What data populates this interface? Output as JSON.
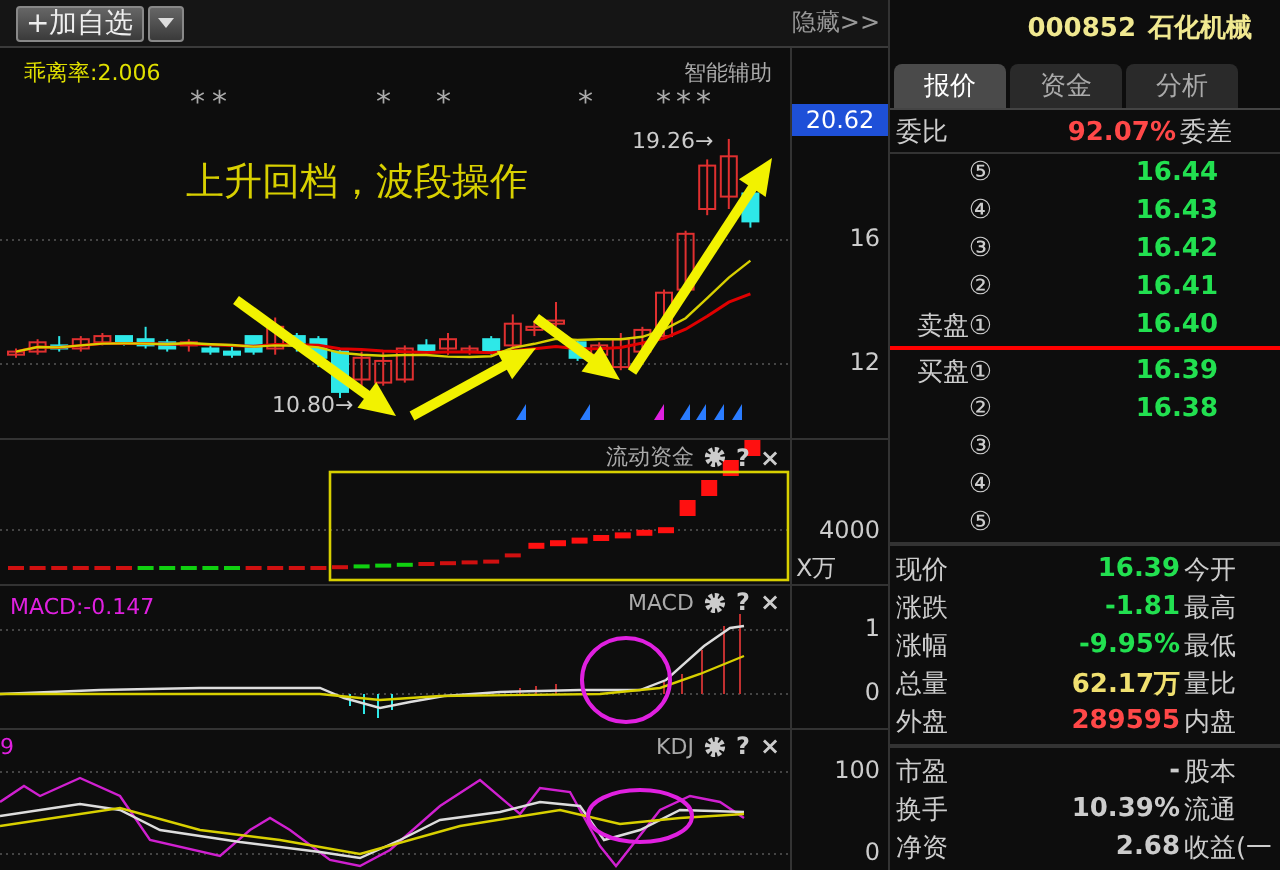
{
  "toolbar": {
    "add_button": "+加自选",
    "hide_link": "隐藏>>"
  },
  "main_chart": {
    "indicator": "乖离率:2.006",
    "assist_label": "智能辅助",
    "stars": [
      "*",
      "*",
      "*",
      "*",
      "*",
      "*",
      "*",
      "*"
    ],
    "annotation": "上升回档，波段操作",
    "low_label": "10.80→",
    "high_label": "19.26→",
    "price_tag": "20.62",
    "axis_labels": [
      "16",
      "12"
    ]
  },
  "fund_panel": {
    "title": "流动资金",
    "help": "?",
    "close": "×",
    "axis_label": "4000",
    "unit": "X万"
  },
  "macd_panel": {
    "value": "MACD:-0.147",
    "title": "MACD",
    "help": "?",
    "close": "×",
    "axis_labels": [
      "1",
      "0"
    ]
  },
  "kdj_panel": {
    "value": "9",
    "title": "KDJ",
    "help": "?",
    "close": "×",
    "axis_labels": [
      "100",
      "0"
    ]
  },
  "quote": {
    "code": "000852",
    "name": "石化机械",
    "tabs": [
      {
        "label": "报价",
        "selected": true
      },
      {
        "label": "资金",
        "selected": false
      },
      {
        "label": "分析",
        "selected": false
      }
    ],
    "ratio_label": "委比",
    "ratio_value": "92.07%",
    "diff_label": "委差",
    "asks": [
      {
        "label": "⑤",
        "price": "16.44"
      },
      {
        "label": "④",
        "price": "16.43"
      },
      {
        "label": "③",
        "price": "16.42"
      },
      {
        "label": "②",
        "price": "16.41"
      },
      {
        "label": "卖盘①",
        "price": "16.40"
      }
    ],
    "bids": [
      {
        "label": "买盘①",
        "price": "16.39"
      },
      {
        "label": "②",
        "price": "16.38"
      },
      {
        "label": "③"
      },
      {
        "label": "④"
      },
      {
        "label": "⑤"
      }
    ],
    "stats": [
      {
        "label": "现价",
        "value": "16.39",
        "color": "#22e050",
        "label2": "今开"
      },
      {
        "label": "涨跌",
        "value": "-1.81",
        "color": "#22e050",
        "label2": "最高"
      },
      {
        "label": "涨幅",
        "value": "-9.95%",
        "color": "#22e050",
        "label2": "最低"
      },
      {
        "label": "总量",
        "value": "62.17万",
        "color": "#f0e070",
        "label2": "量比"
      },
      {
        "label": "外盘",
        "value": "289595",
        "color": "#ff4848",
        "label2": "内盘"
      }
    ],
    "stats2": [
      {
        "label": "市盈",
        "value": "-",
        "label2": "股本"
      },
      {
        "label": "换手",
        "value": "10.39%",
        "label2": "流通"
      },
      {
        "label": "净资",
        "value": "2.68",
        "label2": "收益(一"
      }
    ]
  }
}
